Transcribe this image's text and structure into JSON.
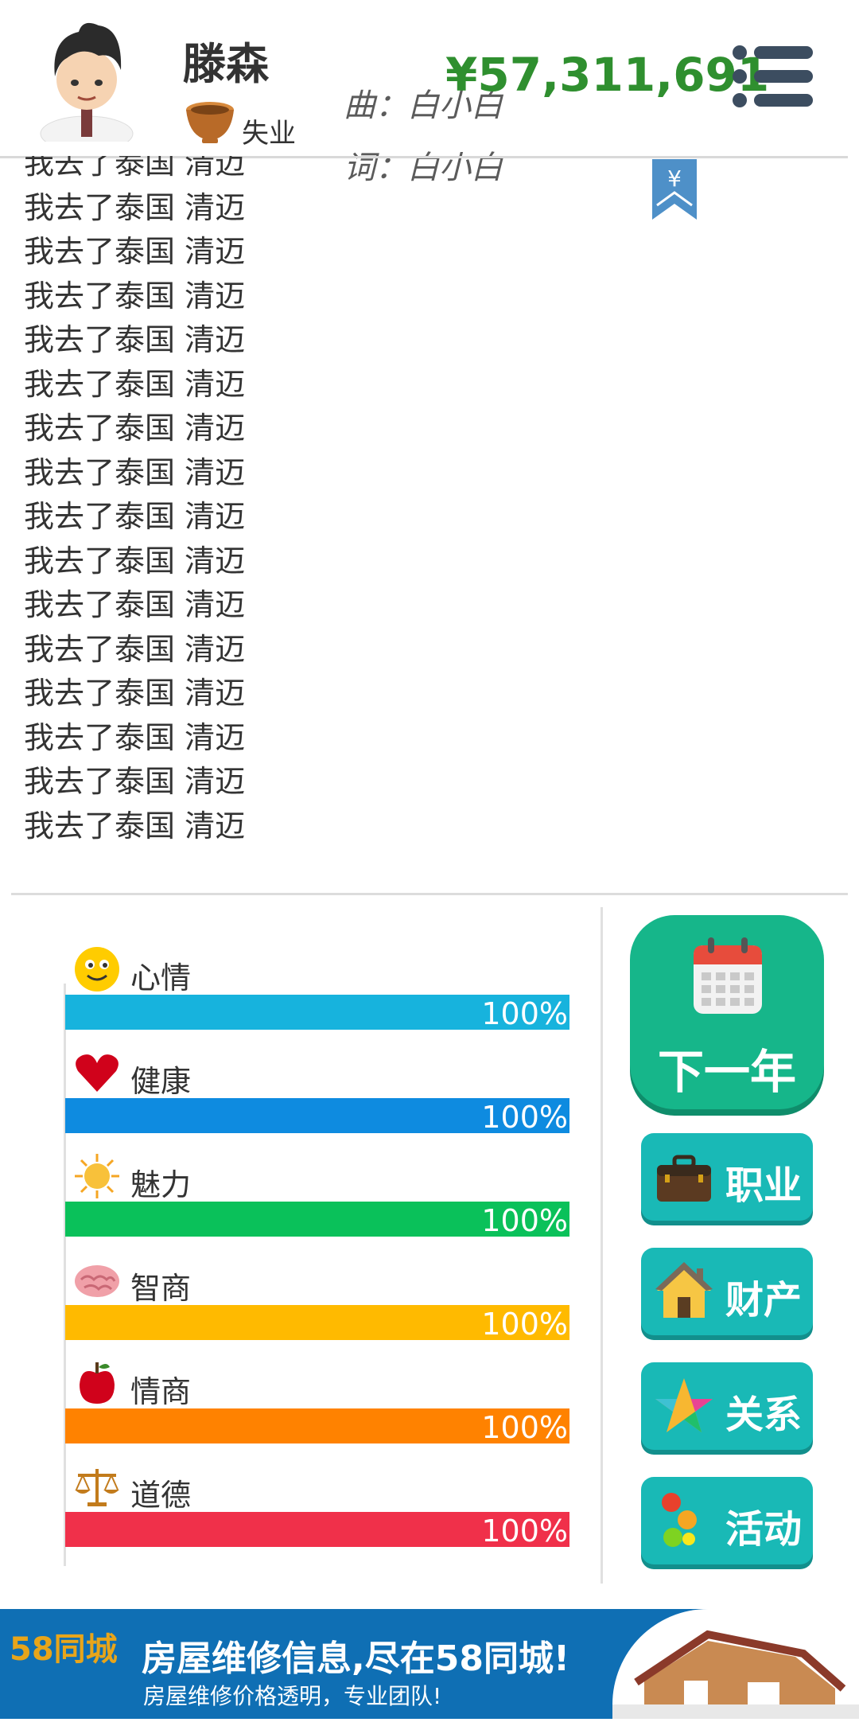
{
  "header": {
    "name": "滕森",
    "job": "失业",
    "credit_line1": "曲：白小白",
    "credit_line2": "词：白小白",
    "money": "¥57,311,691",
    "bookmark_symbol": "¥"
  },
  "log": {
    "lines": [
      "我去了泰国 清迈",
      "我去了泰国 清迈",
      "我去了泰国 清迈",
      "我去了泰国 清迈",
      "我去了泰国 清迈",
      "我去了泰国 清迈",
      "我去了泰国 清迈",
      "我去了泰国 清迈",
      "我去了泰国 清迈",
      "我去了泰国 清迈",
      "我去了泰国 清迈",
      "我去了泰国 清迈",
      "我去了泰国 清迈",
      "我去了泰国 清迈",
      "我去了泰国 清迈",
      "我去了泰国 清迈"
    ]
  },
  "stats": [
    {
      "label": "心情",
      "value": "100%",
      "fraction": 1.0,
      "color": "#17b3dd",
      "icon": "smiley-icon"
    },
    {
      "label": "健康",
      "value": "100%",
      "fraction": 1.0,
      "color": "#0e8be0",
      "icon": "heart-icon"
    },
    {
      "label": "魅力",
      "value": "100%",
      "fraction": 1.0,
      "color": "#0ac15a",
      "icon": "sun-icon"
    },
    {
      "label": "智商",
      "value": "100%",
      "fraction": 1.0,
      "color": "#ffba00",
      "icon": "brain-icon"
    },
    {
      "label": "情商",
      "value": "100%",
      "fraction": 1.0,
      "color": "#ff8200",
      "icon": "apple-icon"
    },
    {
      "label": "道德",
      "value": "100%",
      "fraction": 1.0,
      "color": "#f0304a",
      "icon": "scales-icon"
    }
  ],
  "buttons": {
    "next_year": "下一年",
    "career": "职业",
    "property": "财产",
    "relations": "关系",
    "activities": "活动"
  },
  "ad": {
    "logo": "58同城",
    "headline": "房屋维修信息,尽在58同城!",
    "subline": "房屋维修价格透明，专业团队!"
  }
}
